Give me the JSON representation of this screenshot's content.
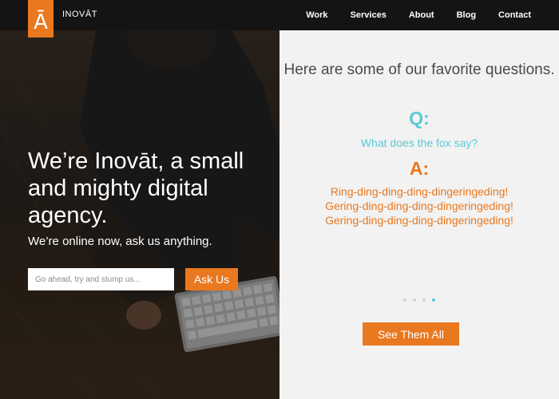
{
  "nav": {
    "logo_glyph": "Ā",
    "brand": "INOVĀT",
    "links": [
      "Work",
      "Services",
      "About",
      "Blog",
      "Contact"
    ]
  },
  "hero": {
    "title": "We’re Inovāt, a small and mighty digital agency.",
    "subtitle": "We’re online now, ask us anything.",
    "search_placeholder": "Go ahead, try and stump us...",
    "ask_label": "Ask Us"
  },
  "panel": {
    "title": "Here are some of our favorite questions.",
    "q_label": "Q:",
    "question": "What does the fox say?",
    "a_label": "A:",
    "answer": "Ring-ding-ding-ding-dingeringeding! Gering-ding-ding-ding-dingeringeding! Gering-ding-ding-ding-dingeringeding!",
    "dots_count": 4,
    "active_dot": 3,
    "see_all_label": "See Them All"
  },
  "colors": {
    "accent_orange": "#e9781f",
    "accent_teal": "#5cc8d6",
    "nav_bg": "#141414",
    "panel_bg": "#f2f2f2"
  }
}
